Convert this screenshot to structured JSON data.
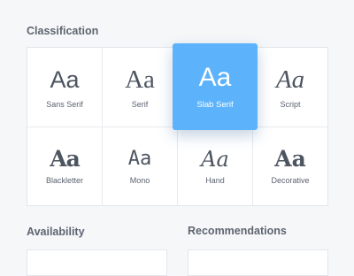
{
  "sections": {
    "classification": "Classification",
    "availability": "Availability",
    "recommendations": "Recommendations"
  },
  "classification_items": [
    {
      "sample": "Aa",
      "label": "Sans Serif"
    },
    {
      "sample": "Aa",
      "label": "Serif"
    },
    {
      "sample": "Aa",
      "label": "Slab Serif",
      "selected": true
    },
    {
      "sample": "Aa",
      "label": "Script"
    },
    {
      "sample": "Aa",
      "label": "Blackletter"
    },
    {
      "sample": "Aa",
      "label": "Mono"
    },
    {
      "sample": "Aa",
      "label": "Hand"
    },
    {
      "sample": "Aa",
      "label": "Decorative"
    }
  ],
  "colors": {
    "accent": "#5cb3fb",
    "text": "#4d5561",
    "heading": "#5e6470",
    "background": "#f6f7f9"
  }
}
